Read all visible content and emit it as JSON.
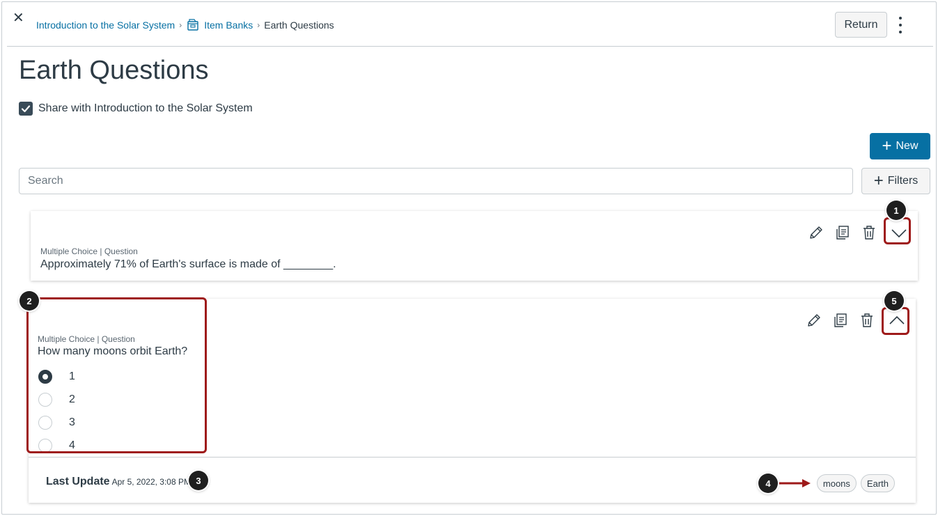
{
  "header": {
    "breadcrumbs": [
      {
        "label": "Introduction to the Solar System"
      },
      {
        "label": "Item Banks"
      },
      {
        "label": "Earth Questions"
      }
    ],
    "return_label": "Return"
  },
  "page": {
    "title": "Earth Questions",
    "share_label": "Share with Introduction to the Solar System",
    "share_checked": true
  },
  "toolbar": {
    "new_label": "New",
    "search_placeholder": "Search",
    "filters_label": "Filters"
  },
  "questions": [
    {
      "meta": "Multiple Choice | Question",
      "text": "Approximately 71% of Earth's surface is made of ________.",
      "expanded": false
    },
    {
      "meta": "Multiple Choice | Question",
      "text": "How many moons orbit Earth?",
      "expanded": true,
      "options": [
        "1",
        "2",
        "3",
        "4"
      ],
      "selected_option": "1",
      "last_update_label": "Last Update",
      "last_update_value": "Apr 5, 2022, 3:08 PM",
      "tags": [
        "moons",
        "Earth"
      ]
    }
  ],
  "callouts": [
    "1",
    "2",
    "3",
    "4",
    "5"
  ],
  "colors": {
    "link": "#0770a3",
    "primary_button": "#0770a3",
    "text": "#2d3b45",
    "highlight": "#9e1a1a",
    "callout": "#1f1f1f"
  },
  "icons": [
    "close-icon",
    "item-bank-icon",
    "kebab-menu-icon",
    "checkmark-icon",
    "plus-icon",
    "pencil-icon",
    "copy-icon",
    "trash-icon",
    "chevron-down-icon",
    "chevron-up-icon",
    "arrow-right-icon"
  ]
}
